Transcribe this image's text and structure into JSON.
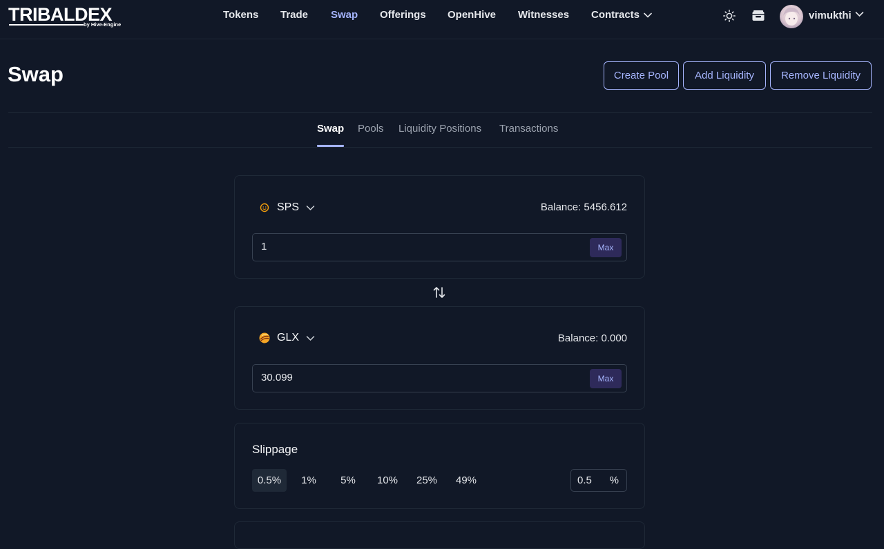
{
  "brand": {
    "name": "TRIBALDEX",
    "sub": "by Hive-Engine"
  },
  "nav": {
    "links": [
      "Tokens",
      "Trade",
      "Swap",
      "Offerings",
      "OpenHive",
      "Witnesses",
      "Contracts"
    ],
    "active": "Swap",
    "user": {
      "name": "vimukthi"
    },
    "icons": [
      "sun-icon",
      "wallet-icon",
      "avatar",
      "chevron-down-icon"
    ]
  },
  "header": {
    "title": "Swap",
    "buttons": [
      "Create Pool",
      "Add Liquidity",
      "Remove Liquidity"
    ]
  },
  "tabs": [
    "Swap",
    "Pools",
    "Liquidity Positions",
    "Transactions"
  ],
  "active_tab": "Swap",
  "swap": {
    "from": {
      "symbol": "SPS",
      "balance": "Balance: 5456.612",
      "amount": "1",
      "max_label": "Max",
      "icon": "sps-token-icon"
    },
    "to": {
      "symbol": "GLX",
      "balance": "Balance: 0.000",
      "amount": "30.099",
      "max_label": "Max",
      "icon": "glx-token-icon"
    }
  },
  "slippage": {
    "title": "Slippage",
    "options": [
      "0.5%",
      "1%",
      "5%",
      "10%",
      "25%",
      "49%"
    ],
    "selected": "0.5%",
    "custom_value": "0.5",
    "unit": "%"
  },
  "colors": {
    "background": "#111827",
    "accent": "#a5b4fc",
    "border": "#1f2937"
  }
}
